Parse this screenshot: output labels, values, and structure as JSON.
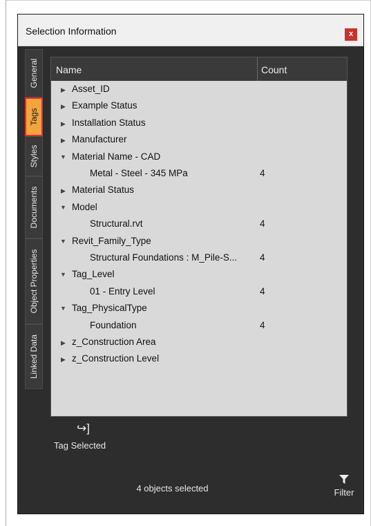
{
  "window": {
    "title": "Selection Information",
    "close_label": "x"
  },
  "tabs": [
    {
      "label": "General"
    },
    {
      "label": "Tags",
      "active": true
    },
    {
      "label": "Styles"
    },
    {
      "label": "Documents"
    },
    {
      "label": "Object Properties"
    },
    {
      "label": "Linked Data"
    }
  ],
  "table": {
    "headers": {
      "name": "Name",
      "count": "Count"
    },
    "rows": [
      {
        "label": "Asset_ID",
        "state": "collapsed"
      },
      {
        "label": "Example Status",
        "state": "collapsed"
      },
      {
        "label": "Installation Status",
        "state": "collapsed"
      },
      {
        "label": "Manufacturer",
        "state": "collapsed"
      },
      {
        "label": "Material Name - CAD",
        "state": "expanded"
      },
      {
        "label": "Metal - Steel - 345 MPa",
        "count": "4",
        "state": "child"
      },
      {
        "label": "Material Status",
        "state": "collapsed"
      },
      {
        "label": "Model",
        "state": "expanded"
      },
      {
        "label": "Structural.rvt",
        "count": "4",
        "state": "child"
      },
      {
        "label": "Revit_Family_Type",
        "state": "expanded"
      },
      {
        "label": "Structural Foundations : M_Pile-S...",
        "count": "4",
        "state": "child"
      },
      {
        "label": "Tag_Level",
        "state": "expanded"
      },
      {
        "label": "01 - Entry Level",
        "count": "4",
        "state": "child"
      },
      {
        "label": "Tag_PhysicalType",
        "state": "expanded"
      },
      {
        "label": "Foundation",
        "count": "4",
        "state": "child"
      },
      {
        "label": "z_Construction Area",
        "state": "collapsed"
      },
      {
        "label": "z_Construction Level",
        "state": "collapsed"
      }
    ]
  },
  "toolbar": {
    "tag_selected_label": "Tag Selected",
    "tag_selected_icon": "tag-arrow-icon"
  },
  "footer": {
    "status": "4 objects selected",
    "filter_label": "Filter",
    "filter_icon": "funnel-icon"
  },
  "colors": {
    "active_tab": "#f2a53d",
    "active_tab_border": "#e03030",
    "close_button": "#c8332e",
    "panel_bg": "#2d2d2d",
    "list_bg": "#d9d9d9"
  }
}
